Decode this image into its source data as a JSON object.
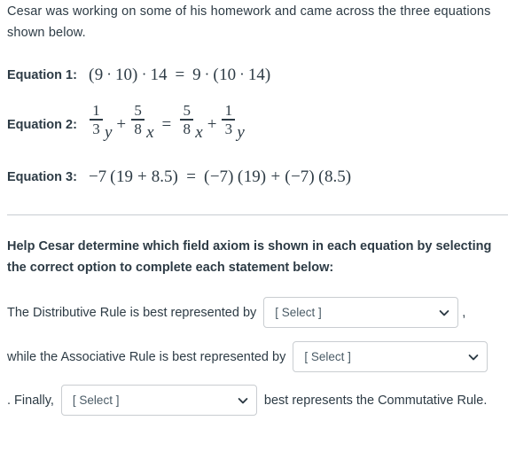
{
  "intro": {
    "text": "Cesar was working on some of his homework and came across the three equations shown below."
  },
  "equations": [
    {
      "label": "Equation 1:",
      "expression": "(9 · 10) · 14 = 9 · (10 · 14)",
      "parts": {
        "lp1": "(",
        "n9": "9",
        "dot1": "·",
        "n10": "10",
        "rp1": ")",
        "dot2": "·",
        "n14": "14",
        "eq": "=",
        "n9b": "9",
        "dot3": "·",
        "lp2": "(",
        "n10b": "10",
        "dot4": "·",
        "n14b": "14",
        "rp2": ")"
      }
    },
    {
      "label": "Equation 2:",
      "expression": "1/3 y + 5/8 x = 5/8 x + 1/3 y",
      "parts": {
        "f1num": "1",
        "f1den": "3",
        "v1": "y",
        "plus1": "+",
        "f2num": "5",
        "f2den": "8",
        "v2": "x",
        "eq": "=",
        "f3num": "5",
        "f3den": "8",
        "v3": "x",
        "plus2": "+",
        "f4num": "1",
        "f4den": "3",
        "v4": "y"
      }
    },
    {
      "label": "Equation 3:",
      "expression": "−7 (19 + 8.5) = (−7) (19) + (−7) (8.5)",
      "parts": {
        "neg7": "−7",
        "lp1": "(",
        "n19": "19",
        "plus1": "+",
        "n85": "8.5",
        "rp1": ")",
        "eq": "=",
        "lp2": "(",
        "neg7b": "−7",
        "rp2": ")",
        "lp3": "(",
        "n19b": "19",
        "rp3": ")",
        "plus2": "+",
        "lp4": "(",
        "neg7c": "−7",
        "rp4": ")",
        "lp5": "(",
        "n85b": "8.5",
        "rp5": ")"
      }
    }
  ],
  "prompt": {
    "text": "Help Cesar determine which field axiom is shown in each equation by selecting the correct option to complete each statement below:"
  },
  "statements": [
    {
      "before": "The Distributive Rule is best represented by",
      "select_value": "[ Select ]",
      "after": ","
    },
    {
      "before": "while the Associative Rule is best represented by",
      "select_value": "[ Select ]",
      "after": ""
    },
    {
      "before": ". Finally,",
      "select_value": "[ Select ]",
      "after": "best represents the Commutative Rule."
    }
  ],
  "colors": {
    "text": "#2d3b45",
    "border": "#c9cdd1",
    "divider": "#c7cdd1",
    "select_text": "#4a5b66",
    "background": "#ffffff"
  }
}
